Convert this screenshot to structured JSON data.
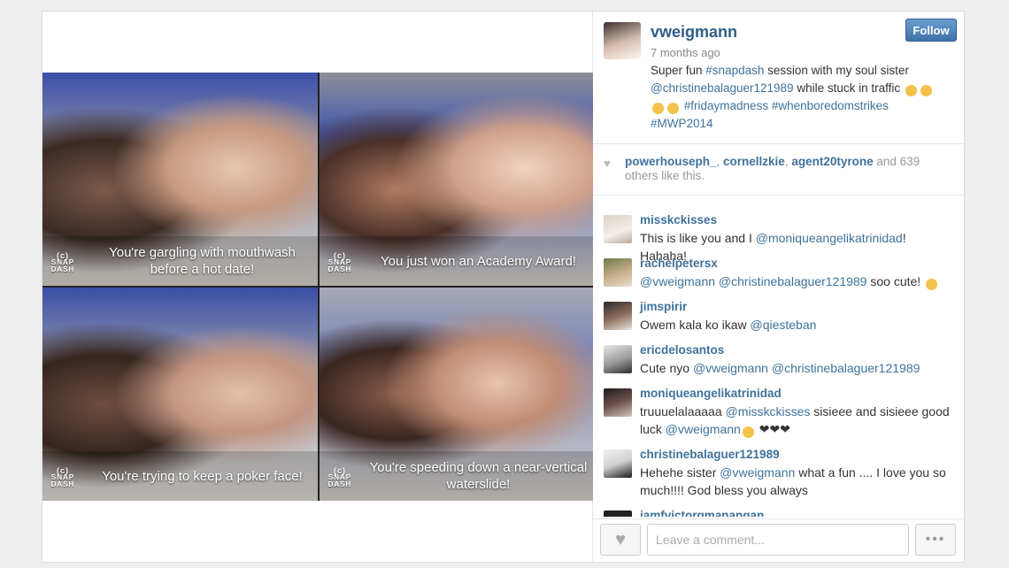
{
  "post": {
    "username": "vweigmann",
    "follow_label": "Follow",
    "time_ago": "7 months ago",
    "caption": {
      "text1": "Super fun ",
      "tag_snapdash": "#snapdash",
      "text2": " session with my soul sister ",
      "mention": "@christinebalaguer121989",
      "text3": " while stuck in traffic ",
      "tag1": "#fridaymadness",
      "tag2": "#whenboredomstrikes",
      "tag3": "#MWP2014"
    }
  },
  "collage": {
    "brand": "SNAP DASH",
    "brand_icon": "(c)",
    "panels": [
      {
        "caption": "You're gargling with mouthwash before a hot date!"
      },
      {
        "caption": "You just won an Academy Award!"
      },
      {
        "caption": "You're trying to keep a poker face!"
      },
      {
        "caption": "You're speeding down a near-vertical waterslide!"
      }
    ]
  },
  "likes": {
    "user1": "powerhouseph_",
    "user2": "cornellzkie",
    "user3": "agent20tyrone",
    "and_text": " and ",
    "count": "639",
    "rest": "others like this."
  },
  "comments": [
    {
      "user": "misskckisses",
      "parts": [
        "This is like you and I ",
        "@moniqueangelikatrinidad",
        "! Hahaha!"
      ]
    },
    {
      "user": "rachelpetersx",
      "parts": [
        "@vweigmann @christinebalaguer121989",
        " soo cute! "
      ]
    },
    {
      "user": "jimspirir",
      "parts": [
        "Owem kala ko ikaw ",
        "@qiesteban",
        ""
      ]
    },
    {
      "user": "ericdelosantos",
      "parts": [
        "Cute nyo ",
        "@vweigmann @christinebalaguer121989",
        ""
      ]
    },
    {
      "user": "moniqueangelikatrinidad",
      "parts": [
        "truuuelalaaaaa ",
        "@misskckisses",
        " sisieee and sisieee good luck ",
        "@vweigmann",
        " ❤❤❤"
      ]
    },
    {
      "user": "christinebalaguer121989",
      "parts": [
        "Hehehe sister ",
        "@vweigmann",
        " what a fun .... I love you so much!!!! God bless you always"
      ]
    },
    {
      "user": "iamfvictorgmanangan",
      "parts": [
        "",
        "",
        ""
      ]
    }
  ],
  "footer": {
    "comment_placeholder": "Leave a comment...",
    "more_label": "•••"
  },
  "colors": {
    "link": "#3f729b",
    "follow_bg": "#3f72a8"
  }
}
